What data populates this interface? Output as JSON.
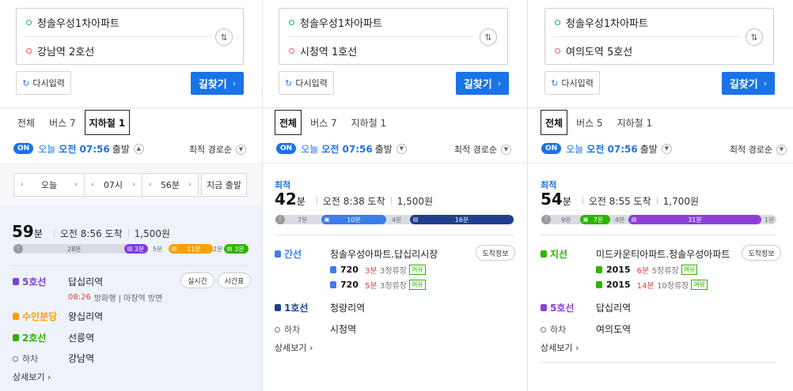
{
  "panels": [
    {
      "origin": "청솔우성1차아파트",
      "destination": "강남역 2호선",
      "reset_label": "다시입력",
      "find_label": "길찾기",
      "tabs": [
        "전체",
        "버스 7",
        "지하철 1"
      ],
      "active_tab": 2,
      "depart": {
        "on": "ON",
        "day": "오늘",
        "time": "오전 07:56",
        "suffix": "출발"
      },
      "sort_label": "최적 경로순",
      "time_picker": {
        "day": "오늘",
        "hour": "07시",
        "minute": "56분",
        "now": "지금 출발"
      },
      "route": {
        "minutes": "59",
        "unit": "분",
        "arrival": "오전 8:56 도착",
        "fare": "1,500원",
        "timeline": [
          {
            "kind": "walk",
            "label": "28분",
            "fraction": 0.5
          },
          {
            "kind": "subway",
            "color": "#7f3ed8",
            "label": "3분",
            "fraction": 0.09
          },
          {
            "kind": "walk",
            "label": "5분",
            "fraction": 0.07
          },
          {
            "kind": "subway",
            "color": "#f5a200",
            "label": "11분",
            "fraction": 0.19
          },
          {
            "kind": "walk",
            "label": "2분",
            "fraction": 0.04
          },
          {
            "kind": "subway",
            "color": "#2db400",
            "label": "3분",
            "fraction": 0.09
          }
        ],
        "steps": [
          {
            "line": "5호선",
            "color": "#7f3ed8",
            "station": "답십리역",
            "sub_time": "08:26",
            "sub_text": "방화행 | 마장역 방면",
            "pill1": "실시간",
            "pill2": "시간표"
          },
          {
            "line": "수인분당",
            "color": "#f5a200",
            "station": "왕십리역"
          },
          {
            "line": "2호선",
            "color": "#2db400",
            "station": "선릉역"
          }
        ],
        "alight": "하차",
        "alight_station": "강남역",
        "detail": "상세보기"
      }
    },
    {
      "origin": "청솔우성1차아파트",
      "destination": "시청역 1호선",
      "reset_label": "다시입력",
      "find_label": "길찾기",
      "tabs": [
        "전체",
        "버스 7",
        "지하철 1"
      ],
      "active_tab": 0,
      "depart": {
        "on": "ON",
        "day": "오늘",
        "time": "오전 07:56",
        "suffix": "출발"
      },
      "sort_label": "최적 경로순",
      "route": {
        "best": "최적",
        "minutes": "42",
        "unit": "분",
        "arrival": "오전 8:38 도착",
        "fare": "1,500원",
        "timeline": [
          {
            "kind": "walk",
            "label": "7분"
          },
          {
            "kind": "bus",
            "color": "#3b7de9",
            "label": "10분"
          },
          {
            "kind": "walk",
            "label": "4분"
          },
          {
            "kind": "subway",
            "color": "#1f3f8f",
            "label": "16분"
          }
        ],
        "bus_step": {
          "line": "간선",
          "color": "#3b7de9",
          "station": "청솔우성아파트.답십리시장",
          "pill": "도착정보",
          "buses": [
            {
              "no": "720",
              "eta": "3분",
              "stops": "3정류장",
              "tag": "여유"
            },
            {
              "no": "720",
              "eta": "5분",
              "stops": "3정류장",
              "tag": "여유"
            }
          ]
        },
        "subway_step": {
          "line": "1호선",
          "color": "#1f3f8f",
          "station": "청량리역"
        },
        "alight": "하차",
        "alight_station": "시청역",
        "detail": "상세보기"
      }
    },
    {
      "origin": "청솔우성1차아파트",
      "destination": "여의도역 5호선",
      "reset_label": "다시입력",
      "find_label": "길찾기",
      "tabs": [
        "전체",
        "버스 5",
        "지하철 1"
      ],
      "active_tab": 0,
      "depart": {
        "on": "ON",
        "day": "오늘",
        "time": "오전 07:56",
        "suffix": "출발"
      },
      "sort_label": "최적 경로순",
      "route": {
        "best": "최적",
        "minutes": "54",
        "unit": "분",
        "arrival": "오전 8:55 도착",
        "fare": "1,700원",
        "timeline": [
          {
            "kind": "walk",
            "label": "9분"
          },
          {
            "kind": "bus",
            "color": "#2db400",
            "label": "7분"
          },
          {
            "kind": "walk",
            "label": "4분"
          },
          {
            "kind": "subway",
            "color": "#8b3fd8",
            "label": "31분"
          },
          {
            "kind": "walk",
            "label": "1분"
          }
        ],
        "bus_step": {
          "line": "지선",
          "color": "#2db400",
          "station": "미드카운티아파트.청솔우성아파트",
          "pill": "도착정보",
          "buses": [
            {
              "no": "2015",
              "eta": "6분",
              "stops": "5정류장",
              "tag": "여유"
            },
            {
              "no": "2015",
              "eta": "14분",
              "stops": "10정류장",
              "tag": "여유"
            }
          ]
        },
        "subway_step": {
          "line": "5호선",
          "color": "#8b3fd8",
          "station": "답십리역"
        },
        "alight": "하차",
        "alight_station": "여의도역",
        "detail": "상세보기"
      }
    }
  ]
}
